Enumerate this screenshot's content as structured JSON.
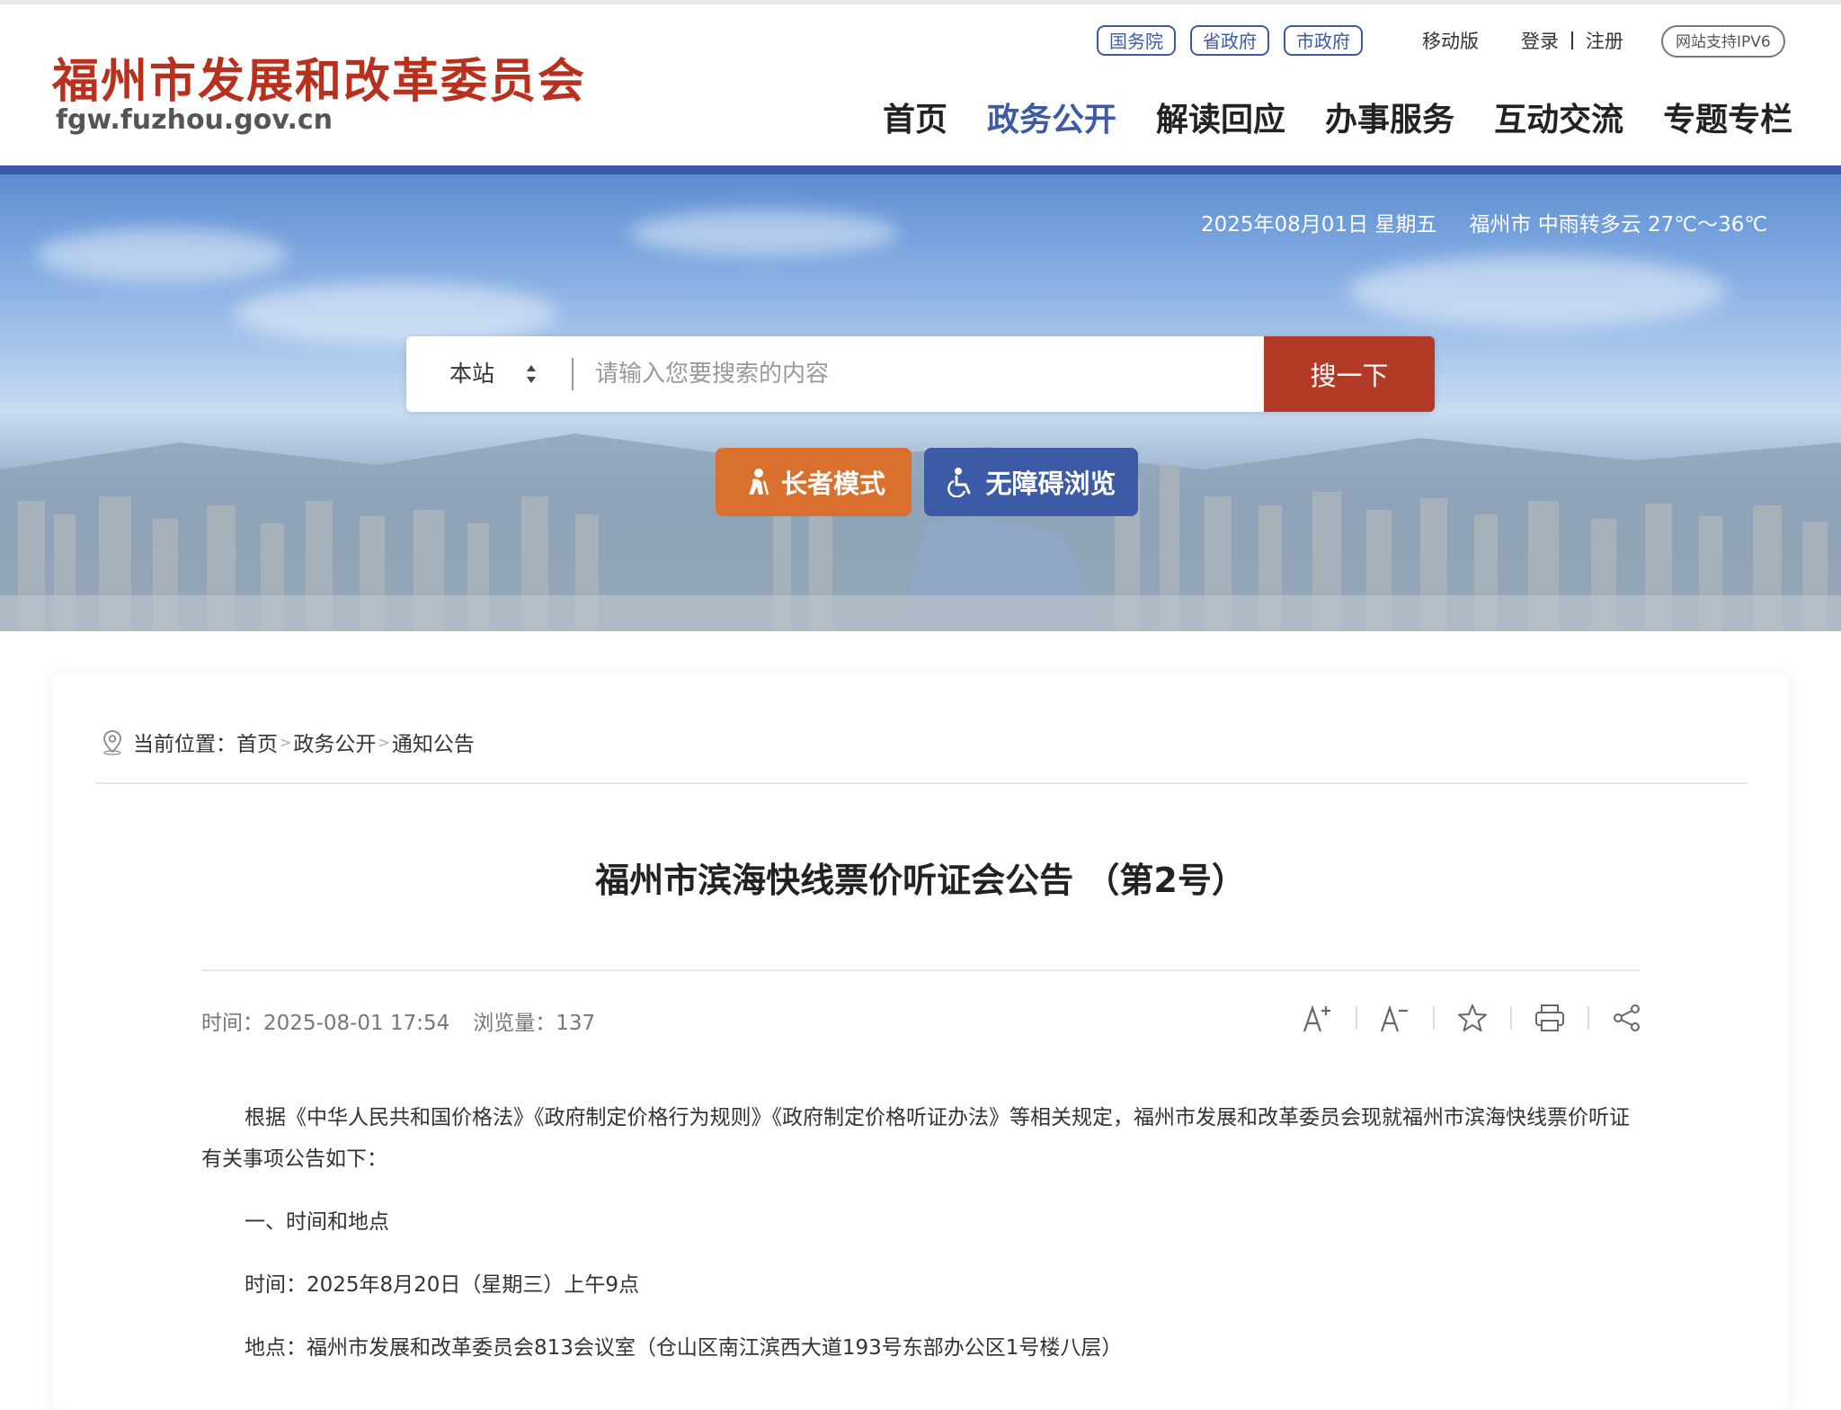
{
  "header": {
    "logo_cn": "福州市发展和改革委员会",
    "logo_en": "fgw.fuzhou.gov.cn",
    "gov_links": [
      "国务院",
      "省政府",
      "市政府"
    ],
    "mobile": "移动版",
    "login": "登录",
    "register": "注册",
    "ipv6": "网站支持IPV6",
    "nav": [
      "首页",
      "政务公开",
      "解读回应",
      "办事服务",
      "互动交流",
      "专题专栏"
    ],
    "active_nav": "政务公开"
  },
  "banner": {
    "date": "2025年08月01日 星期五",
    "weather": "福州市 中雨转多云 27℃～36℃",
    "search_scope": "本站",
    "search_placeholder": "请输入您要搜索的内容",
    "search_button": "搜一下",
    "elder_mode": "长者模式",
    "accessible_mode": "无障碍浏览"
  },
  "article": {
    "breadcrumb_label": "当前位置：",
    "breadcrumb": [
      "首页",
      "政务公开",
      "通知公告"
    ],
    "title": "福州市滨海快线票价听证会公告 （第2号）",
    "time_label": "时间：",
    "time": "2025-08-01 17:54",
    "views_label": "浏览量：",
    "views": "137",
    "paragraphs": [
      "根据《中华人民共和国价格法》《政府制定价格行为规则》《政府制定价格听证办法》等相关规定，福州市发展和改革委员会现就福州市滨海快线票价听证有关事项公告如下：",
      "一、时间和地点",
      "时间：2025年8月20日（星期三）上午9点",
      "地点：福州市发展和改革委员会813会议室（仓山区南江滨西大道193号东部办公区1号楼八层）"
    ]
  },
  "colors": {
    "brand_red": "#b8311e",
    "nav_blue": "#3c5aa6",
    "search_red": "#b23a26",
    "elder_orange": "#d9702e"
  },
  "icons": [
    "location-icon",
    "font-increase-icon",
    "font-decrease-icon",
    "star-icon",
    "print-icon",
    "share-icon",
    "elder-icon",
    "wheelchair-icon"
  ]
}
